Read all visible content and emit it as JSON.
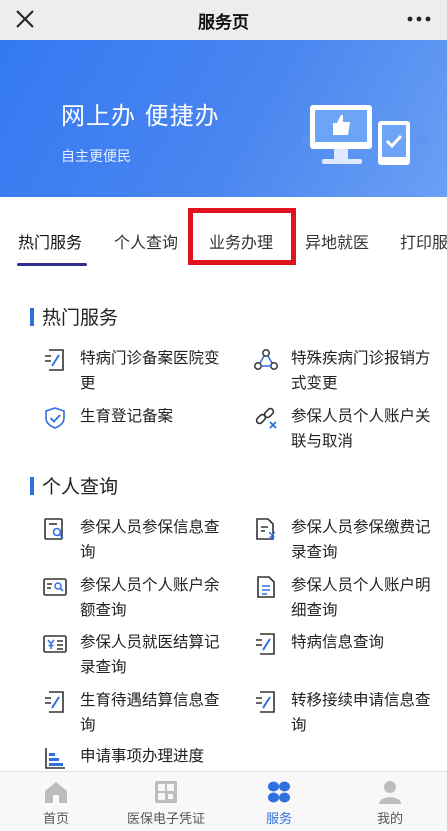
{
  "header": {
    "title": "服务页",
    "close_icon": "close-icon",
    "more_icon": "more-icon"
  },
  "banner": {
    "title": "网上办 便捷办",
    "subtitle": "自主更便民"
  },
  "tabs": [
    {
      "label": "热门服务",
      "active": true
    },
    {
      "label": "个人查询",
      "active": false
    },
    {
      "label": "业务办理",
      "active": false,
      "highlighted": true
    },
    {
      "label": "异地就医",
      "active": false
    },
    {
      "label": "打印服",
      "active": false
    }
  ],
  "sections": [
    {
      "title": "热门服务",
      "items": [
        {
          "label": "特病门诊备案医院变更",
          "icon": "file-edit-icon"
        },
        {
          "label": "特殊疾病门诊报销方式变更",
          "icon": "network-icon"
        },
        {
          "label": "生育登记备案",
          "icon": "shield-check-icon"
        },
        {
          "label": "参保人员个人账户关联与取消",
          "icon": "link-remove-icon"
        }
      ]
    },
    {
      "title": "个人查询",
      "items": [
        {
          "label": "参保人员参保信息查询",
          "icon": "doc-search-icon"
        },
        {
          "label": "参保人员参保缴费记录查询",
          "icon": "doc-yen-icon"
        },
        {
          "label": "参保人员个人账户余额查询",
          "icon": "card-search-icon"
        },
        {
          "label": "参保人员个人账户明细查询",
          "icon": "doc-icon"
        },
        {
          "label": "参保人员就医结算记录查询",
          "icon": "yen-list-icon"
        },
        {
          "label": "特病信息查询",
          "icon": "file-edit-icon"
        },
        {
          "label": "生育待遇结算信息查询",
          "icon": "file-edit-icon"
        },
        {
          "label": "转移接续申请信息查询",
          "icon": "file-edit-icon"
        },
        {
          "label": "申请事项办理进度",
          "icon": "progress-icon"
        }
      ]
    }
  ],
  "bottom_nav": [
    {
      "label": "首页",
      "icon": "home-icon",
      "active": false
    },
    {
      "label": "医保电子凭证",
      "icon": "qr-card-icon",
      "active": false
    },
    {
      "label": "服务",
      "icon": "service-grid-icon",
      "active": true
    },
    {
      "label": "我的",
      "icon": "user-icon",
      "active": false
    }
  ],
  "colors": {
    "accent": "#2f6fe0",
    "banner": "#3478f2",
    "highlight": "#e0141e",
    "tab_underline": "#2f2f8f"
  }
}
